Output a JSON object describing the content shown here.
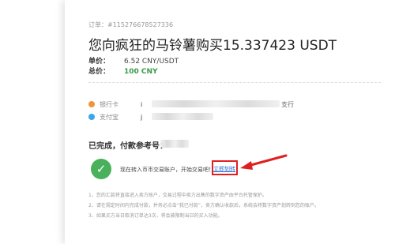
{
  "order": {
    "number": "订单：#115276678527336"
  },
  "title": "您向疯狂的马铃薯购买15.337423 USDT",
  "price": {
    "label": "单价：",
    "value": "6.52 CNY/USDT"
  },
  "total": {
    "label": "总价：",
    "value": "100 CNY"
  },
  "payments": [
    {
      "name": "银行卡",
      "prefix": "i",
      "suffix": "支行",
      "icon_color": "#f0953a",
      "icon": "bank-card-icon"
    },
    {
      "name": "支付宝",
      "prefix": "j",
      "icon_color": "#3aa6e6",
      "icon": "alipay-icon"
    }
  ],
  "status": {
    "text": "已完成，付款参考号："
  },
  "transfer": {
    "text": "现在转入币币交易账户，开始交易吧！",
    "link": "立即划转",
    "check_color": "#49b15b",
    "highlight_color": "#e02020"
  },
  "notes": [
    "1、您的汇款将直接进入卖方账户，交易过程中卖方出售的数字资产由平台托管保护。",
    "2、请在规定时间内完成付款，并务必点击“我已付款”，卖方确认收款后，系统会将数字资产划转到您的账户。",
    "3、如果买方当日取消订单达3次，将会被限制当日的买入功能。"
  ]
}
